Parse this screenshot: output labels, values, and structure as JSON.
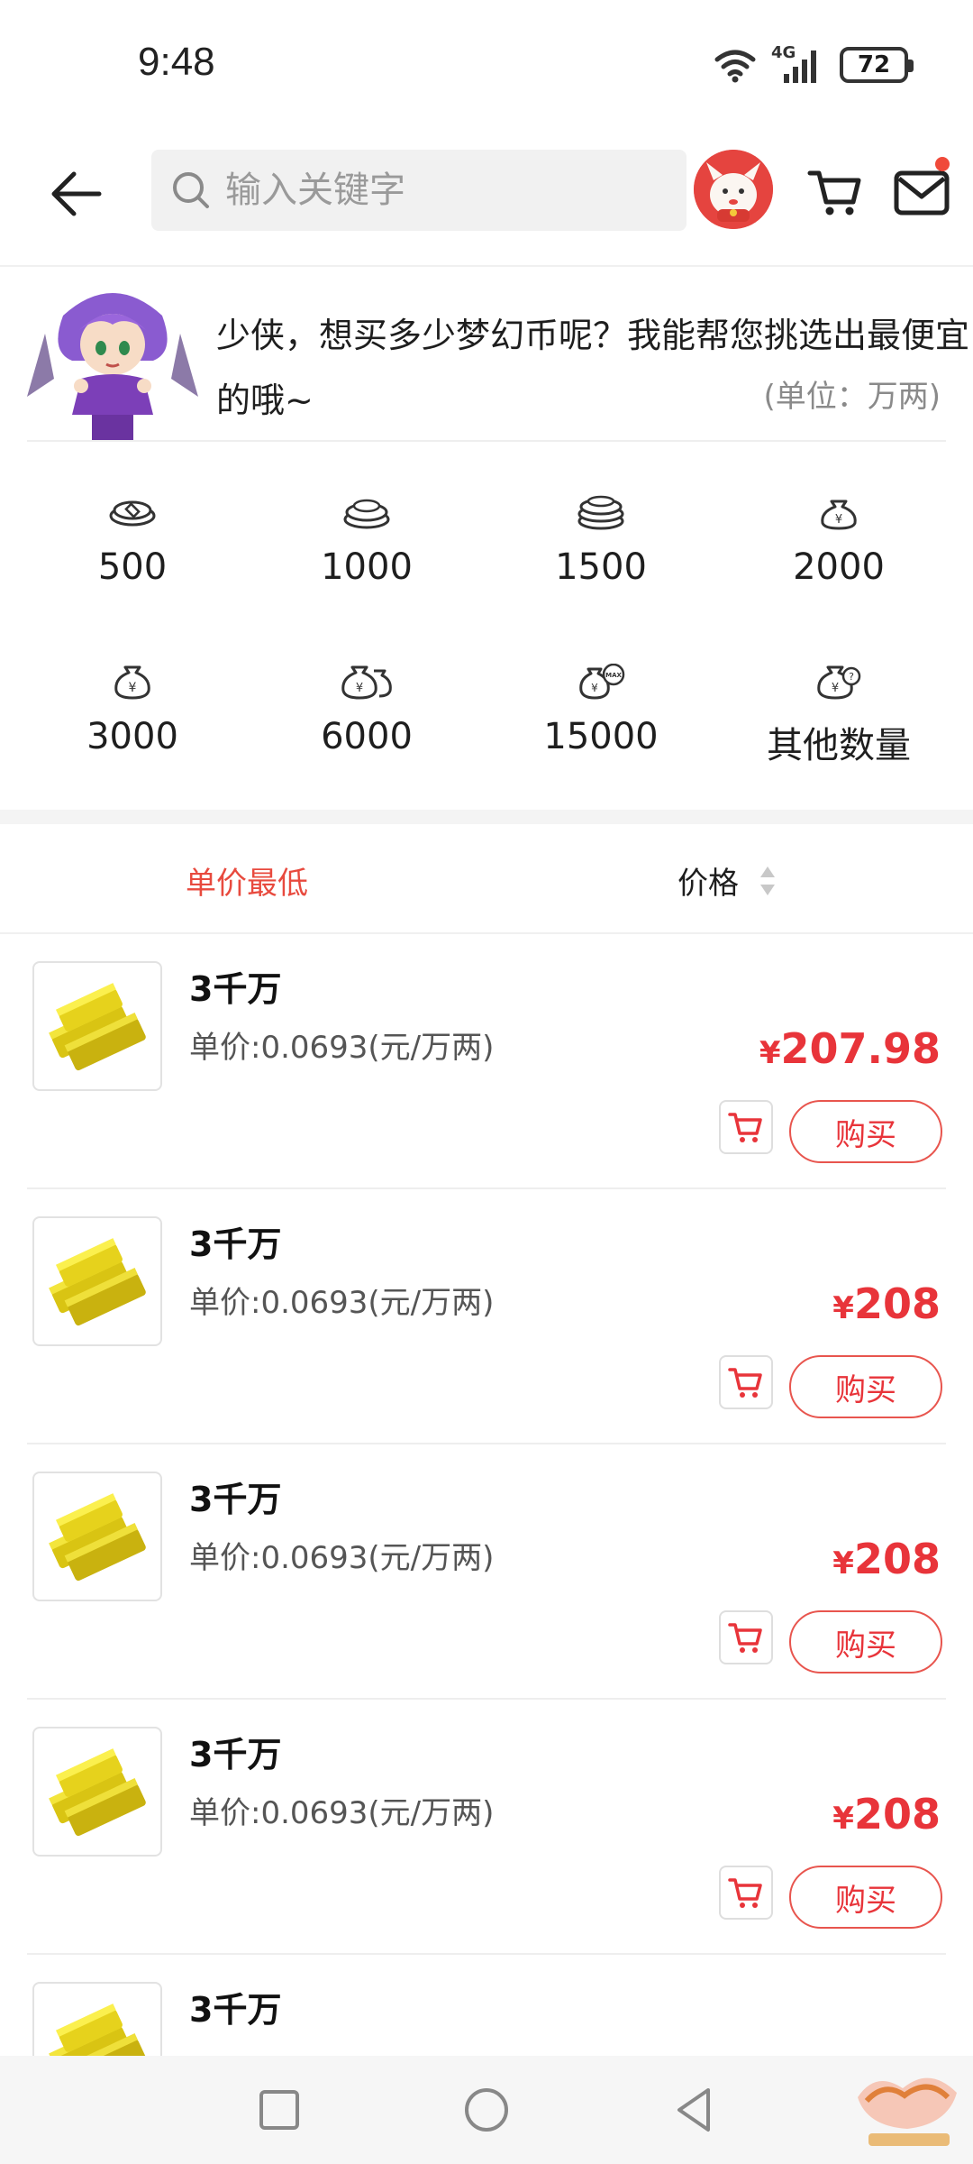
{
  "status_bar": {
    "time": "9:48",
    "network": "4G",
    "battery": "72"
  },
  "header": {
    "search_placeholder": "输入关键字",
    "icons": [
      "back-arrow-icon",
      "search-icon",
      "cart-icon",
      "mail-icon"
    ],
    "mail_has_notification": true
  },
  "intro": {
    "message": "少侠，想买多少梦幻币呢？我能帮您挑选出最便宜的哦~",
    "unit_note": "(单位：万两)"
  },
  "amounts": [
    {
      "label": "500",
      "icon": "coins-small-icon"
    },
    {
      "label": "1000",
      "icon": "coins-stack-icon"
    },
    {
      "label": "1500",
      "icon": "coins-tall-stack-icon"
    },
    {
      "label": "2000",
      "icon": "money-bag-icon"
    },
    {
      "label": "3000",
      "icon": "yuan-bag-icon"
    },
    {
      "label": "6000",
      "icon": "yuan-bags-icon"
    },
    {
      "label": "15000",
      "icon": "max-bag-icon"
    },
    {
      "label": "其他数量",
      "icon": "question-bag-icon"
    }
  ],
  "sort": {
    "lowest_unit_price": "单价最低",
    "price": "价格"
  },
  "items": [
    {
      "title": "3千万",
      "unit_price": "单价:0.0693(元/万两)",
      "price_symbol": "¥",
      "price": "207.98",
      "buy_label": "购买"
    },
    {
      "title": "3千万",
      "unit_price": "单价:0.0693(元/万两)",
      "price_symbol": "¥",
      "price": "208",
      "buy_label": "购买"
    },
    {
      "title": "3千万",
      "unit_price": "单价:0.0693(元/万两)",
      "price_symbol": "¥",
      "price": "208",
      "buy_label": "购买"
    },
    {
      "title": "3千万",
      "unit_price": "单价:0.0693(元/万两)",
      "price_symbol": "¥",
      "price": "208",
      "buy_label": "购买"
    },
    {
      "title": "3千万",
      "unit_price": "",
      "price_symbol": "",
      "price": "",
      "buy_label": ""
    }
  ],
  "colors": {
    "accent_red": "#e8343a",
    "gold": "#e9d81e",
    "divider": "#eeeeee"
  }
}
